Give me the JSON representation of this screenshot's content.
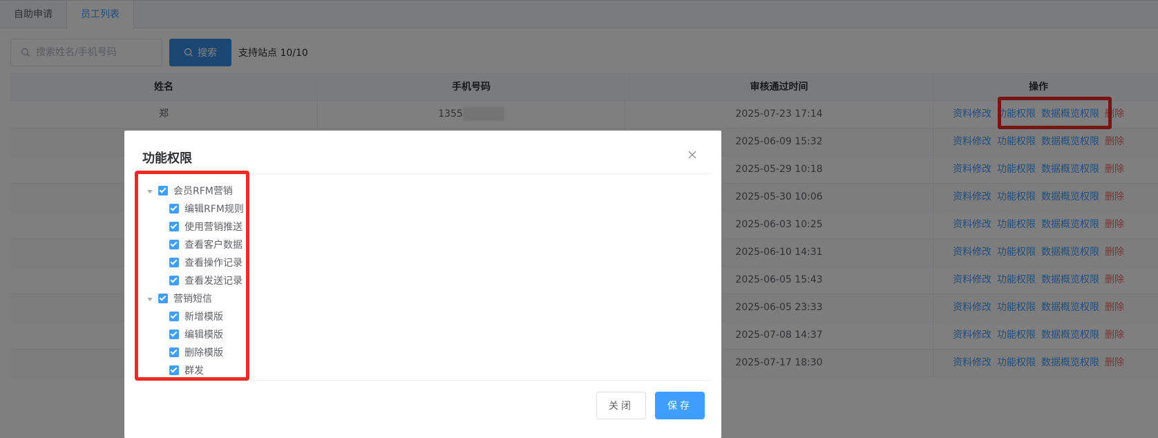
{
  "tabs": [
    {
      "label": "自助申请",
      "active": false
    },
    {
      "label": "员工列表",
      "active": true
    }
  ],
  "search": {
    "placeholder": "搜索姓名/手机号码",
    "button_label": "搜索",
    "site_count": "支持站点 10/10"
  },
  "table": {
    "headers": [
      "姓名",
      "手机号码",
      "审核通过时间",
      "操作"
    ],
    "rows": [
      {
        "name": "郑",
        "phone": "1355",
        "time": "2025-07-23 17:14"
      },
      {
        "name": "",
        "phone": "",
        "time": "2025-06-09 15:32"
      },
      {
        "name": "",
        "phone": "",
        "time": "2025-05-29 10:18"
      },
      {
        "name": "",
        "phone": "",
        "time": "2025-05-30 10:06"
      },
      {
        "name": "",
        "phone": "",
        "time": "2025-06-03 10:25"
      },
      {
        "name": "",
        "phone": "",
        "time": "2025-06-10 14:31"
      },
      {
        "name": "",
        "phone": "",
        "time": "2025-06-05 15:43"
      },
      {
        "name": "",
        "phone": "",
        "time": "2025-06-05 23:33"
      },
      {
        "name": "",
        "phone": "",
        "time": "2025-07-08 14:37"
      },
      {
        "name": "",
        "phone": "",
        "time": "2025-07-17 18:30"
      }
    ],
    "actions": {
      "edit": "资料修改",
      "func_perm": "功能权限",
      "data_perm": "数据概览权限",
      "delete": "删除"
    }
  },
  "dialog": {
    "title": "功能权限",
    "tree": [
      {
        "label": "会员RFM营销",
        "checked": true,
        "children": [
          {
            "label": "编辑RFM规则",
            "checked": true
          },
          {
            "label": "使用营销推送",
            "checked": true
          },
          {
            "label": "查看客户数据",
            "checked": true
          },
          {
            "label": "查看操作记录",
            "checked": true
          },
          {
            "label": "查看发送记录",
            "checked": true
          }
        ]
      },
      {
        "label": "营销短信",
        "checked": true,
        "children": [
          {
            "label": "新增模版",
            "checked": true
          },
          {
            "label": "编辑模版",
            "checked": true
          },
          {
            "label": "删除模版",
            "checked": true
          },
          {
            "label": "群发",
            "checked": true
          }
        ]
      }
    ],
    "close_label": "关闭",
    "save_label": "保存"
  },
  "colors": {
    "primary": "#409eff",
    "danger": "#f56c6c",
    "highlight": "#ee2a24"
  }
}
